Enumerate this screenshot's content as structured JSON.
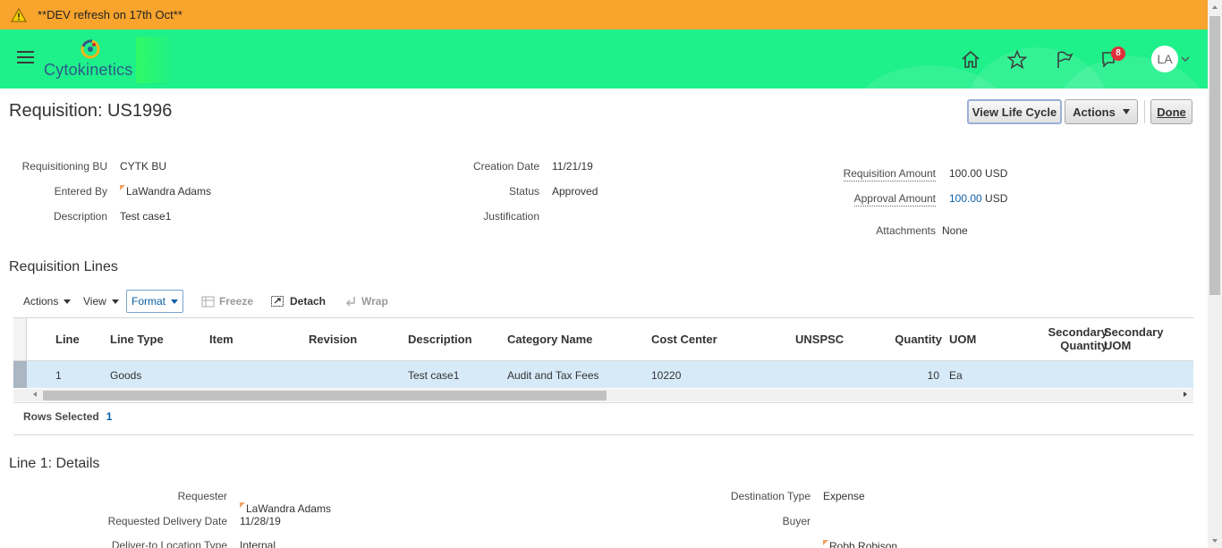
{
  "banner": {
    "text": "**DEV refresh on 17th Oct**",
    "color": "#f8a42d"
  },
  "header": {
    "brand": "Cytokinetics",
    "color": "#1ef08a",
    "icons": [
      "home-icon",
      "star-icon",
      "flag-icon",
      "notifications-icon"
    ],
    "notification_count": "8",
    "avatar_initials": "LA"
  },
  "page": {
    "title": "Requisition: US1996",
    "buttons": {
      "life_cycle": "View Life Cycle",
      "actions": "Actions",
      "done": "Done"
    }
  },
  "summary": {
    "requisitioning_bu_label": "Requisitioning BU",
    "requisitioning_bu": "CYTK BU",
    "entered_by_label": "Entered By",
    "entered_by": "LaWandra Adams",
    "description_label": "Description",
    "description": "Test case1",
    "creation_date_label": "Creation Date",
    "creation_date": "11/21/19",
    "status_label": "Status",
    "status": "Approved",
    "justification_label": "Justification",
    "requisition_amount_label": "Requisition Amount",
    "requisition_amount": "100.00",
    "requisition_currency": "USD",
    "approval_amount_label": "Approval Amount",
    "approval_amount": "100.00",
    "approval_currency": "USD",
    "attachments_label": "Attachments",
    "attachments": "None"
  },
  "lines": {
    "heading": "Requisition Lines",
    "toolbar": {
      "actions": "Actions",
      "view": "View",
      "format": "Format",
      "freeze": "Freeze",
      "detach": "Detach",
      "wrap": "Wrap"
    },
    "columns": [
      "Line",
      "Line Type",
      "Item",
      "Revision",
      "Description",
      "Category Name",
      "Cost Center",
      "UNSPSC",
      "Quantity",
      "UOM",
      "Secondary Quantity",
      "Secondary UOM"
    ],
    "secondary_quantity": [
      "Secondary",
      "Quantity"
    ],
    "secondary_uom": [
      "Secondary",
      "UOM"
    ],
    "rows": [
      {
        "line": "1",
        "line_type": "Goods",
        "item": "",
        "revision": "",
        "description": "Test case1",
        "category": "Audit and Tax Fees",
        "cost_center": "10220",
        "unspsc": "",
        "quantity": "10",
        "uom": "Ea"
      }
    ],
    "rows_selected_label": "Rows Selected",
    "rows_selected": "1"
  },
  "details": {
    "heading": "Line 1: Details",
    "requester_label": "Requester",
    "requester": "LaWandra Adams",
    "requested_delivery_date_label": "Requested Delivery Date",
    "requested_delivery_date": "11/28/19",
    "deliver_to_location_type_label": "Deliver-to Location Type",
    "deliver_to_location_type": "Internal",
    "destination_type_label": "Destination Type",
    "destination_type": "Expense",
    "buyer_label": "Buyer",
    "buyer": "Robb Robison"
  }
}
